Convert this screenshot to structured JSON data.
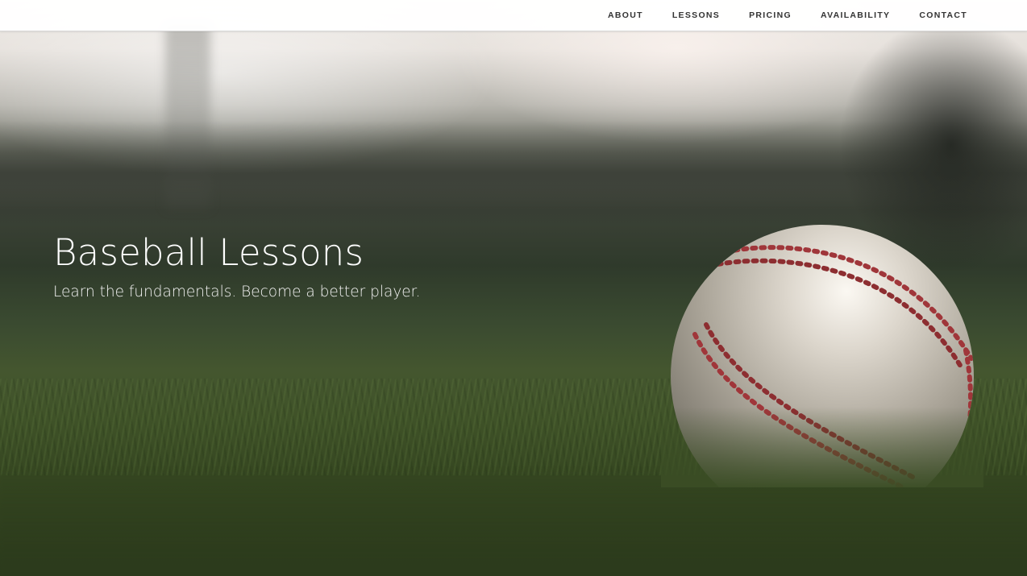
{
  "nav": {
    "items": [
      {
        "label": "ABOUT"
      },
      {
        "label": "LESSONS"
      },
      {
        "label": "PRICING"
      },
      {
        "label": "AVAILABILITY"
      },
      {
        "label": "CONTACT"
      }
    ]
  },
  "hero": {
    "title": "Baseball Lessons",
    "subtitle": "Learn the fundamentals. Become a better player.",
    "image": "baseball-on-grass-photo"
  },
  "colors": {
    "nav_background": "#ffffff",
    "nav_text": "#333333",
    "hero_text": "#ffffff",
    "grass": "#3f5228",
    "stitching": "#a0363a"
  }
}
